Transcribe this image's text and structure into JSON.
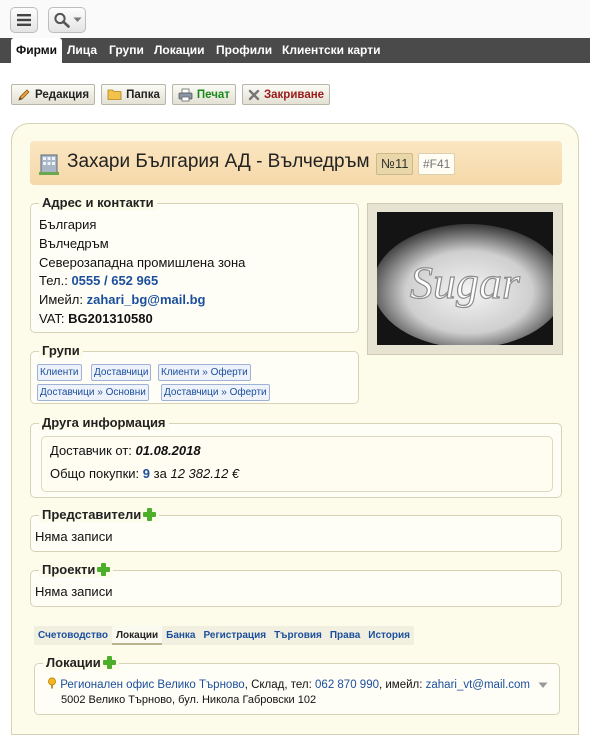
{
  "header": {
    "menu_icon": "hamburger-icon",
    "search_icon": "search-icon",
    "tabs": [
      {
        "label": "Фирми",
        "active": true
      },
      {
        "label": "Лица",
        "active": false
      },
      {
        "label": "Групи",
        "active": false
      },
      {
        "label": "Локации",
        "active": false
      },
      {
        "label": "Профили",
        "active": false
      },
      {
        "label": "Клиентски карти",
        "active": false
      }
    ]
  },
  "toolbar": {
    "edit_label": "Редакция",
    "folder_label": "Папка",
    "print_label": "Печат",
    "close_label": "Закриване"
  },
  "company": {
    "title": "Захари България АД - Вълчедръм",
    "number": "№11",
    "code": "#F41"
  },
  "address": {
    "legend": "Адрес и контакти",
    "country": "България",
    "city": "Вълчедръм",
    "zone": "Северозападна промишлена зона",
    "phone_label": "Тел.:",
    "phone": "0555 / 652 965",
    "email_label": "Имейл:",
    "email": "zahari_bg@mail.bg",
    "vat_label": "VAT:",
    "vat": "BG201310580"
  },
  "groups": {
    "legend": "Групи",
    "tags": [
      "Клиенти",
      "Доставчици",
      "Клиенти » Оферти",
      "Доставчици » Основни",
      "Доставчици » Оферти"
    ]
  },
  "other_info": {
    "legend": "Друга информация",
    "supplier_label": "Доставчик от:",
    "supplier_date": "01.08.2018",
    "total_label": "Общо покупки:",
    "total_count": "9",
    "total_for": "за",
    "total_amount": "12 382.12 €"
  },
  "representatives": {
    "legend": "Представители",
    "empty": "Няма записи"
  },
  "projects": {
    "legend": "Проекти",
    "empty": "Няма записи"
  },
  "subtabs": [
    {
      "label": "Счетоводство",
      "active": false
    },
    {
      "label": "Локации",
      "active": true
    },
    {
      "label": "Банка",
      "active": false
    },
    {
      "label": "Регистрация",
      "active": false
    },
    {
      "label": "Търговия",
      "active": false
    },
    {
      "label": "Права",
      "active": false
    },
    {
      "label": "История",
      "active": false
    }
  ],
  "locations": {
    "legend": "Локации",
    "item_name": "Регионален офис Велико Търново",
    "item_sep1": ", Склад, тел:",
    "item_phone": "062 870 990",
    "item_sep2": ", имейл:",
    "item_email": "zahari_vt@mail.com",
    "item_address": "5002 Велико Търново, бул. Никола Габровски 102"
  },
  "photo_text": "Sugar",
  "colors": {
    "link": "#1b4f9c",
    "tab_bar": "#4a4a4a",
    "card_bg": "#fdfbe9",
    "title_bg": "#f5d8a8",
    "plus_green": "#4caf2a"
  }
}
